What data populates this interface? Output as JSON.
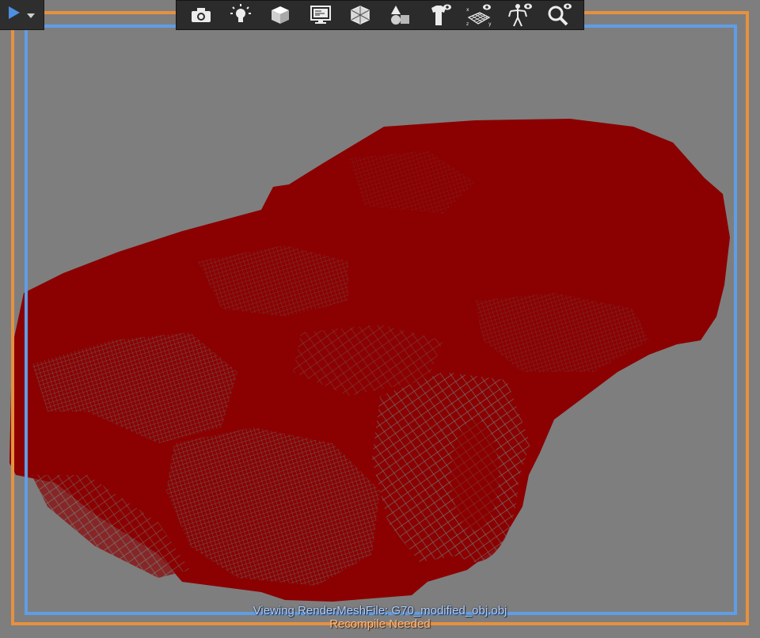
{
  "app": {
    "play_menu": {
      "icon": "play-icon",
      "dropdown_icon": "chevron-down-icon"
    }
  },
  "toolbar": {
    "buttons": [
      {
        "name": "camera",
        "icon": "camera-icon"
      },
      {
        "name": "lights",
        "icon": "lightbulb-icon"
      },
      {
        "name": "shading",
        "icon": "cube-icon"
      },
      {
        "name": "display",
        "icon": "monitor-icon"
      },
      {
        "name": "wireframe",
        "icon": "wire-cube-icon"
      },
      {
        "name": "primitives",
        "icon": "shapes-icon"
      },
      {
        "name": "clothing-visibility",
        "icon": "shirt-eye-icon"
      },
      {
        "name": "grid-visibility",
        "icon": "grid-eye-icon"
      },
      {
        "name": "skeleton-visibility",
        "icon": "skeleton-eye-icon"
      },
      {
        "name": "zoom-visibility",
        "icon": "magnifier-eye-icon"
      }
    ]
  },
  "viewport": {
    "background_color": "#7e7e7e",
    "mesh_color": "#8b0000",
    "outer_frame_color": "#e6913f",
    "inner_frame_color": "#5f9de6"
  },
  "status": {
    "viewing_text": "Viewing RenderMeshFile: G70_modified_obj.obj",
    "recompile_text": "Recompile Needed"
  }
}
